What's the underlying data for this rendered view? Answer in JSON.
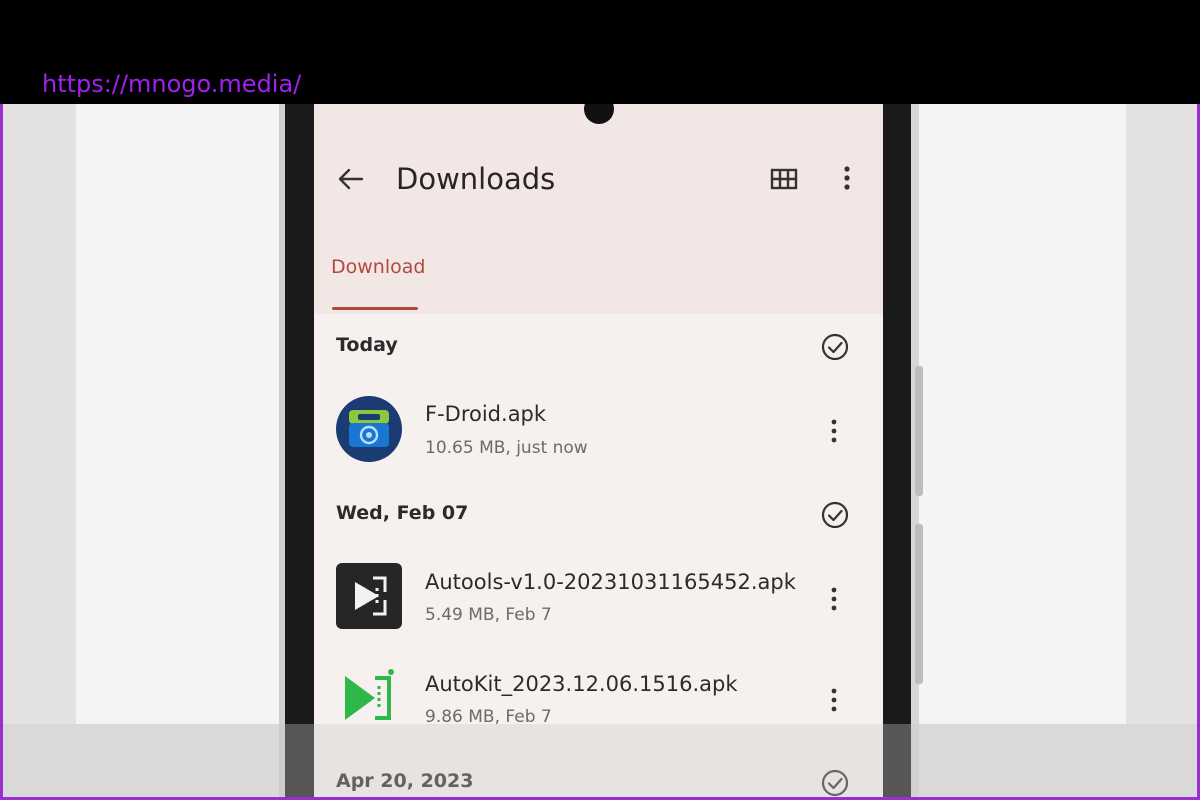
{
  "browser": {
    "url": "https://mnogo.media/"
  },
  "appbar": {
    "title": "Downloads"
  },
  "tabs": [
    {
      "label": "Download"
    }
  ],
  "sections": [
    {
      "label": "Today",
      "items": [
        {
          "name": "F-Droid.apk",
          "meta": "10.65 MB, just now"
        }
      ]
    },
    {
      "label": "Wed, Feb 07",
      "items": [
        {
          "name": "Autools-v1.0-20231031165452.apk",
          "meta": "5.49 MB, Feb 7"
        },
        {
          "name": "AutoKit_2023.12.06.1516.apk",
          "meta": "9.86 MB, Feb 7"
        }
      ]
    },
    {
      "label": "Apr 20, 2023",
      "items": []
    }
  ],
  "colors": {
    "accent": "#b04a3e",
    "appbar_bg": "#f3e7e5",
    "screen_bg": "#f6f1ef",
    "url_color": "#a020f0"
  },
  "icons": {
    "back": "arrow-left-icon",
    "grid": "grid-view-icon",
    "more": "more-vert-icon",
    "check": "check-circle-icon",
    "fdroid": "fdroid-app-icon",
    "autools": "autools-app-icon",
    "autokit": "autokit-app-icon"
  }
}
